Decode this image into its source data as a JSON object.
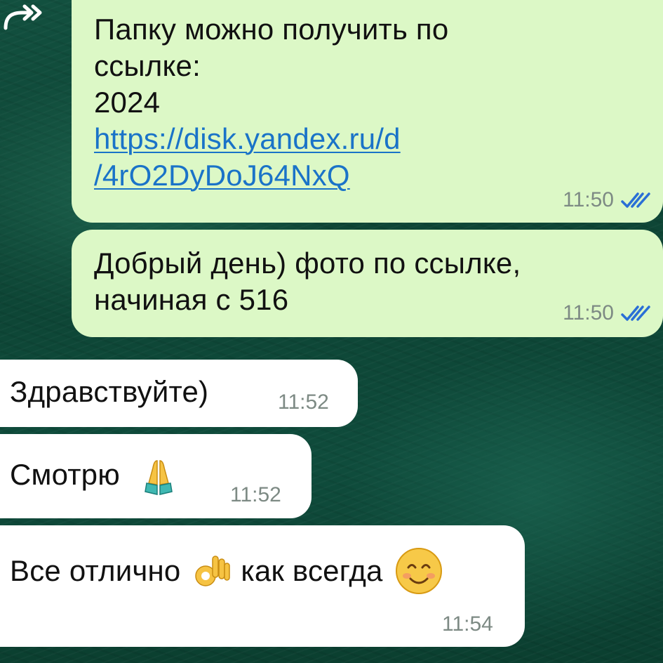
{
  "chat": {
    "forward_icon": "forward-arrow-icon",
    "accent_colors": {
      "outgoing_bubble": "#dcf8c6",
      "incoming_bubble": "#ffffff",
      "link": "#1a73c8",
      "read_ticks": "#2a6fd6"
    },
    "messages": [
      {
        "direction": "outgoing",
        "forwarded": true,
        "lines": [
          "Папку можно получить по",
          "ссылке:",
          "2024"
        ],
        "link_lines": [
          "https://disk.yandex.ru/d",
          "/4rO2DyDoJ64NxQ"
        ],
        "time": "11:50",
        "status_icon": "double-check-read-icon"
      },
      {
        "direction": "outgoing",
        "lines": [
          "Добрый день) фото по ссылке,",
          "начиная с 516"
        ],
        "time": "11:50",
        "status_icon": "double-check-read-icon"
      },
      {
        "direction": "incoming",
        "text": "Здравствуйте)",
        "time": "11:52"
      },
      {
        "direction": "incoming",
        "text": "Смотрю",
        "emoji": "folded-hands-emoji",
        "time": "11:52"
      },
      {
        "direction": "incoming",
        "text_before": "Все отлично",
        "emoji_1": "ok-hand-emoji",
        "text_after": "как всегда",
        "emoji_2": "smiling-face-emoji",
        "time": "11:54"
      }
    ]
  }
}
